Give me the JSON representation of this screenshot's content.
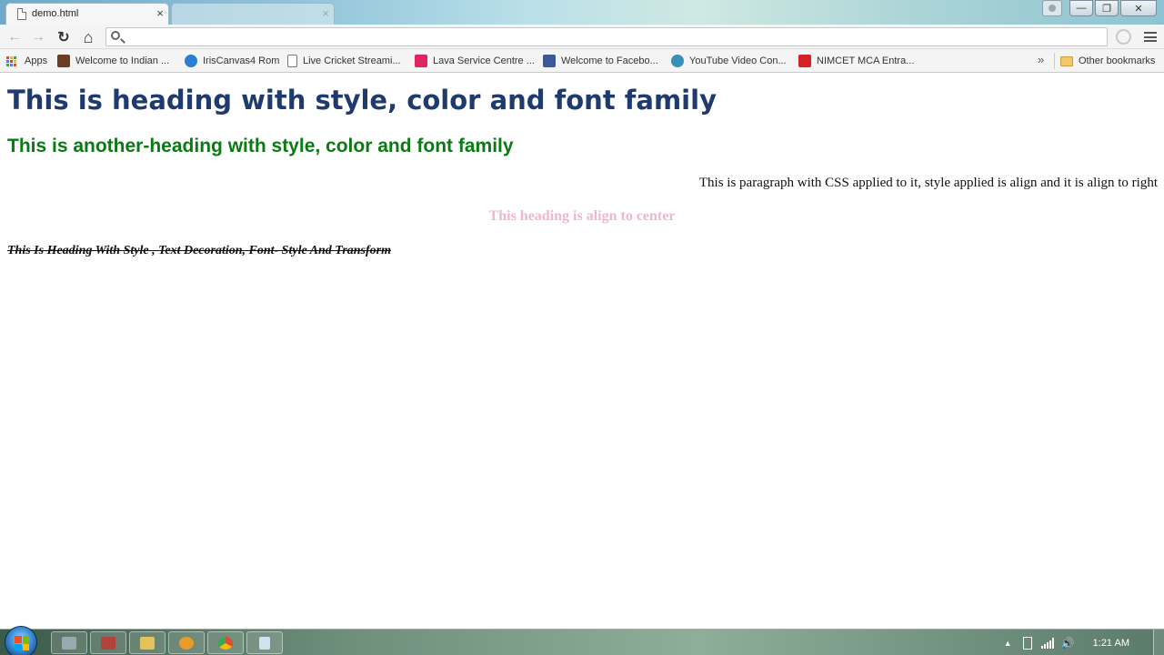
{
  "browser": {
    "active_tab": {
      "title": "demo.html",
      "close_glyph": "×"
    },
    "inactive_tab": {
      "title": "",
      "close_glyph": "×"
    },
    "address_bar": {
      "value": "",
      "placeholder": ""
    },
    "nav": {
      "back_glyph": "←",
      "forward_glyph": "→",
      "reload_glyph": "↻",
      "home_glyph": "⌂"
    },
    "window_controls": {
      "minimize": "—",
      "maximize": "❐",
      "close": "✕"
    }
  },
  "bookmarks": {
    "items": [
      {
        "label": "Apps",
        "icon": "apps-grid-icon"
      },
      {
        "label": "Welcome to Indian ...",
        "icon": "indian-railways-icon",
        "color": "#6b3e26"
      },
      {
        "label": "IrisCanvas4 Rom",
        "icon": "iris-canvas-icon",
        "color": "#2a7fd4"
      },
      {
        "label": "Live Cricket Streami...",
        "icon": "page-icon",
        "color": "#ffffff"
      },
      {
        "label": "Lava Service Centre ...",
        "icon": "lava-icon",
        "color": "#e0245e"
      },
      {
        "label": "Welcome to Facebo...",
        "icon": "facebook-icon",
        "color": "#3b5998"
      },
      {
        "label": "YouTube Video Con...",
        "icon": "converter-icon",
        "color": "#3a8fb7"
      },
      {
        "label": "NIMCET MCA Entra...",
        "icon": "nimcet-icon",
        "color": "#d71f26"
      }
    ],
    "overflow": "»",
    "other_bookmarks": "Other bookmarks"
  },
  "content": {
    "heading1": "This is heading with style, color and font family",
    "heading2": "This is another-heading with style, color and font family",
    "paragraph": "This is paragraph with CSS applied to it, style applied is align and it is align to right",
    "heading3": "This heading is align to center",
    "heading4": "This Is Heading With Style , Text Decoration, Font- Style And Transform"
  },
  "colors": {
    "heading1": "#1f3a6e",
    "heading2": "#0a7a14",
    "heading3": "#f3b6c4"
  },
  "taskbar": {
    "buttons": [
      {
        "name": "media-center-icon",
        "color": "#9aa8b0"
      },
      {
        "name": "presentation-app-icon",
        "color": "#b0433a"
      },
      {
        "name": "file-explorer-icon",
        "color": "#e6c15a"
      },
      {
        "name": "media-player-icon",
        "color": "#e89a2c"
      },
      {
        "name": "chrome-icon",
        "color": "#dd4b39"
      },
      {
        "name": "notepad-icon",
        "color": "#cfe3ee"
      }
    ],
    "tray_arrow": "▲",
    "volume_glyph": "🔊",
    "clock": "1:21 AM"
  }
}
